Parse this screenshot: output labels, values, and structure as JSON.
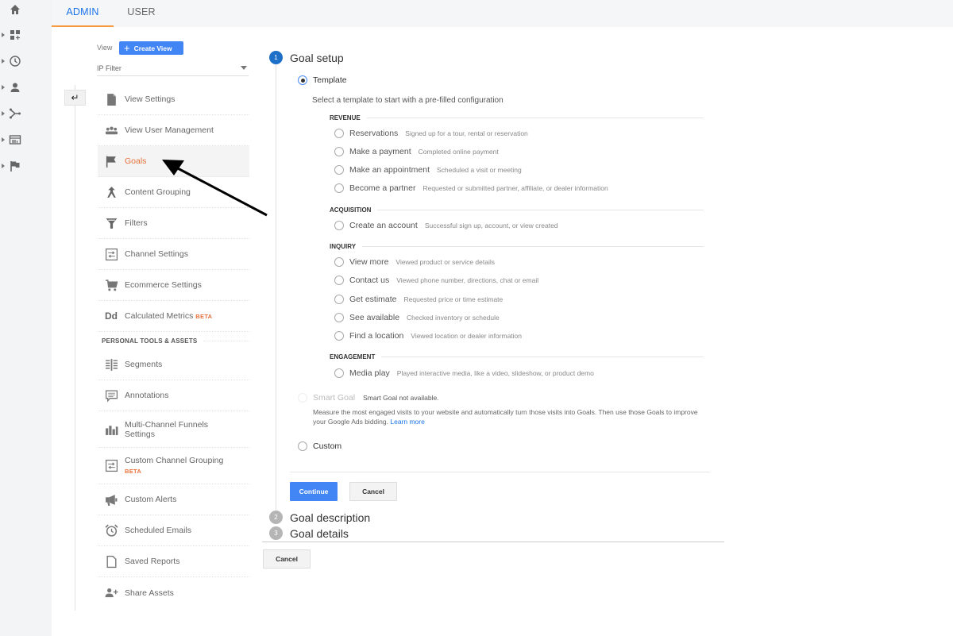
{
  "rail": {
    "items": [
      {
        "icon": "home-icon",
        "has_caret": false
      },
      {
        "icon": "dashboard-icon",
        "has_caret": true
      },
      {
        "icon": "clock-icon",
        "has_caret": true
      },
      {
        "icon": "person-icon",
        "has_caret": true
      },
      {
        "icon": "acquisition-icon",
        "has_caret": true
      },
      {
        "icon": "behavior-icon",
        "has_caret": true
      },
      {
        "icon": "flag-icon",
        "has_caret": true
      }
    ]
  },
  "tabs": {
    "admin": "ADMIN",
    "user": "USER",
    "active": "ADMIN"
  },
  "view": {
    "label": "View",
    "create_button": "Create View",
    "selected": "IP Filter"
  },
  "menu": {
    "items": [
      {
        "label": "View Settings",
        "icon": "document-icon"
      },
      {
        "label": "View User Management",
        "icon": "users-icon"
      },
      {
        "label": "Goals",
        "icon": "flag-icon",
        "active": true
      },
      {
        "label": "Content Grouping",
        "icon": "content-grouping-icon"
      },
      {
        "label": "Filters",
        "icon": "filter-icon"
      },
      {
        "label": "Channel Settings",
        "icon": "channel-settings-icon"
      },
      {
        "label": "Ecommerce Settings",
        "icon": "cart-icon"
      },
      {
        "label": "Calculated Metrics",
        "icon": "dd-icon",
        "icon_text": "Dd",
        "badge": "BETA"
      }
    ],
    "section_header": "PERSONAL TOOLS & ASSETS",
    "personal_items": [
      {
        "label": "Segments",
        "icon": "segments-icon"
      },
      {
        "label": "Annotations",
        "icon": "annotation-icon"
      },
      {
        "label": "Multi-Channel Funnels Settings",
        "icon": "bar-chart-icon"
      },
      {
        "label": "Custom Channel Grouping",
        "icon": "channel-grouping-icon",
        "badge": "BETA"
      },
      {
        "label": "Custom Alerts",
        "icon": "megaphone-icon"
      },
      {
        "label": "Scheduled Emails",
        "icon": "alarm-clock-icon"
      },
      {
        "label": "Saved Reports",
        "icon": "saved-report-icon"
      },
      {
        "label": "Share Assets",
        "icon": "add-person-icon"
      }
    ]
  },
  "goal": {
    "steps": [
      {
        "number": "1",
        "title": "Goal setup",
        "active": true
      },
      {
        "number": "2",
        "title": "Goal description",
        "active": false
      },
      {
        "number": "3",
        "title": "Goal details",
        "active": false
      }
    ],
    "template_label": "Template",
    "template_selected": true,
    "template_description": "Select a template to start with a pre-filled configuration",
    "categories": [
      {
        "name": "REVENUE",
        "options": [
          {
            "name": "Reservations",
            "desc": "Signed up for a tour, rental or reservation"
          },
          {
            "name": "Make a payment",
            "desc": "Completed online payment"
          },
          {
            "name": "Make an appointment",
            "desc": "Scheduled a visit or meeting"
          },
          {
            "name": "Become a partner",
            "desc": "Requested or submitted partner, affiliate, or dealer information"
          }
        ]
      },
      {
        "name": "ACQUISITION",
        "options": [
          {
            "name": "Create an account",
            "desc": "Successful sign up, account, or view created"
          }
        ]
      },
      {
        "name": "INQUIRY",
        "options": [
          {
            "name": "View more",
            "desc": "Viewed product or service details"
          },
          {
            "name": "Contact us",
            "desc": "Viewed phone number, directions, chat or email"
          },
          {
            "name": "Get estimate",
            "desc": "Requested price or time estimate"
          },
          {
            "name": "See available",
            "desc": "Checked inventory or schedule"
          },
          {
            "name": "Find a location",
            "desc": "Viewed location or dealer information"
          }
        ]
      },
      {
        "name": "ENGAGEMENT",
        "options": [
          {
            "name": "Media play",
            "desc": "Played interactive media, like a video, slideshow, or product demo"
          }
        ]
      }
    ],
    "smart_goal": {
      "label": "Smart Goal",
      "status": "Smart Goal not available.",
      "description": "Measure the most engaged visits to your website and automatically turn those visits into Goals. Then use those Goals to improve your Google Ads bidding.",
      "learn_more": "Learn more"
    },
    "custom_label": "Custom",
    "continue_button": "Continue",
    "cancel_button": "Cancel",
    "bottom_cancel_button": "Cancel"
  },
  "colors": {
    "accent_blue": "#4285f4",
    "active_orange": "#e8703a",
    "tab_underline": "#f59b3d",
    "step_active": "#1e6fc8"
  }
}
